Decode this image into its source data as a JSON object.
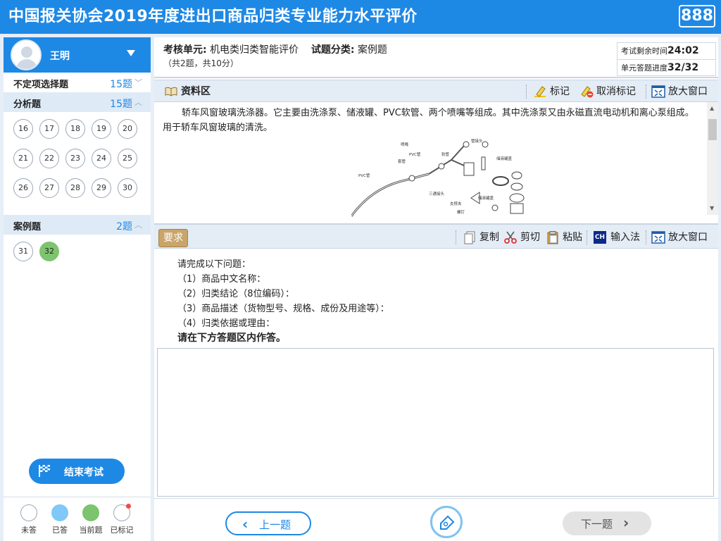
{
  "header": {
    "title": "中国报关协会2019年度进出口商品归类专业能力水平评价",
    "seat_number": "888"
  },
  "user": {
    "name": "王明"
  },
  "sections": [
    {
      "label": "不定项选择题",
      "count": "15题",
      "expanded": false,
      "questions": []
    },
    {
      "label": "分析题",
      "count": "15题",
      "expanded": true,
      "questions": [
        "16",
        "17",
        "18",
        "19",
        "20",
        "21",
        "22",
        "23",
        "24",
        "25",
        "26",
        "27",
        "28",
        "29",
        "30"
      ]
    },
    {
      "label": "案例题",
      "count": "2题",
      "expanded": true,
      "questions": [
        "31",
        "32"
      ],
      "current": "32"
    }
  ],
  "end_exam_label": "结束考试",
  "legend": [
    {
      "label": "未答",
      "state": "unanswered"
    },
    {
      "label": "已答",
      "state": "answered"
    },
    {
      "label": "当前题",
      "state": "current"
    },
    {
      "label": "已标记",
      "state": "marked"
    }
  ],
  "info": {
    "unit_label": "考核单元:",
    "unit_value": "机电类归类智能评价",
    "category_label": "试题分类:",
    "category_value": "案例题",
    "score_summary": "（共2题，共10分）",
    "time_label": "考试剩余时间",
    "time_value": "24:02",
    "progress_label": "单元答题进度",
    "progress_value": "32/32"
  },
  "material_toolbar": {
    "title": "资料区",
    "mark": "标记",
    "unmark": "取消标记",
    "enlarge": "放大窗口"
  },
  "material": {
    "text": "轿车风窗玻璃洗涤器。它主要由洗涤泵、储液罐、PVC软管、两个喷嘴等组成。其中洗涤泵又由永磁直流电动机和离心泵组成。用于轿车风窗玻璃的清洗。",
    "diagram_labels": [
      "喷嘴",
      "管接头",
      "PVC管",
      "套管",
      "软管",
      "储液罐盖",
      "PVC管",
      "三通接头",
      "支撑夹",
      "储液罐盖",
      "螺钉"
    ]
  },
  "requirement_toolbar": {
    "tag": "要求",
    "copy": "复制",
    "cut": "剪切",
    "paste": "粘贴",
    "ime_badge": "CH",
    "ime": "输入法",
    "enlarge": "放大窗口"
  },
  "requirements": {
    "intro": "请完成以下问题：",
    "items": [
      "（1）商品中文名称：",
      "（2）归类结论（8位编码）：",
      "（3）商品描述（货物型号、规格、成份及用途等）：",
      "（4）归类依据或理由："
    ],
    "instruction": "请在下方答题区内作答。"
  },
  "answer_value": "",
  "nav": {
    "prev": "上一题",
    "next": "下一题"
  }
}
